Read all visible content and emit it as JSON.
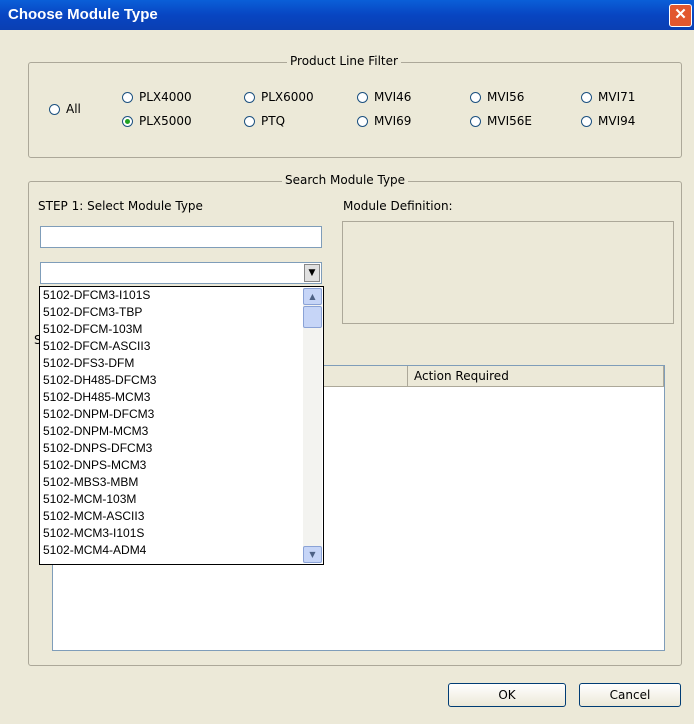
{
  "window": {
    "title": "Choose Module Type",
    "close_label": "✕"
  },
  "filter": {
    "legend": "Product Line Filter",
    "options": [
      {
        "label": "All",
        "checked": false
      },
      {
        "label": "PLX4000",
        "checked": false
      },
      {
        "label": "PLX6000",
        "checked": false
      },
      {
        "label": "MVI46",
        "checked": false
      },
      {
        "label": "MVI56",
        "checked": false
      },
      {
        "label": "MVI71",
        "checked": false
      },
      {
        "label": "PLX5000",
        "checked": true
      },
      {
        "label": "PTQ",
        "checked": false
      },
      {
        "label": "MVI69",
        "checked": false
      },
      {
        "label": "MVI56E",
        "checked": false
      },
      {
        "label": "MVI94",
        "checked": false
      }
    ]
  },
  "search": {
    "legend": "Search Module Type",
    "step1_label": "STEP 1: Select Module Type",
    "module_def_label": "Module Definition:",
    "search_value": "",
    "combo_value": ""
  },
  "table": {
    "col_action": "Action Required",
    "partial_label": "S"
  },
  "dropdown": {
    "items": [
      "5102-DFCM3-I101S",
      "5102-DFCM3-TBP",
      "5102-DFCM-103M",
      "5102-DFCM-ASCII3",
      "5102-DFS3-DFM",
      "5102-DH485-DFCM3",
      "5102-DH485-MCM3",
      "5102-DNPM-DFCM3",
      "5102-DNPM-MCM3",
      "5102-DNPS-DFCM3",
      "5102-DNPS-MCM3",
      "5102-MBS3-MBM",
      "5102-MCM-103M",
      "5102-MCM-ASCII3",
      "5102-MCM3-I101S",
      "5102-MCM4-ADM4"
    ]
  },
  "buttons": {
    "ok": "OK",
    "cancel": "Cancel"
  }
}
